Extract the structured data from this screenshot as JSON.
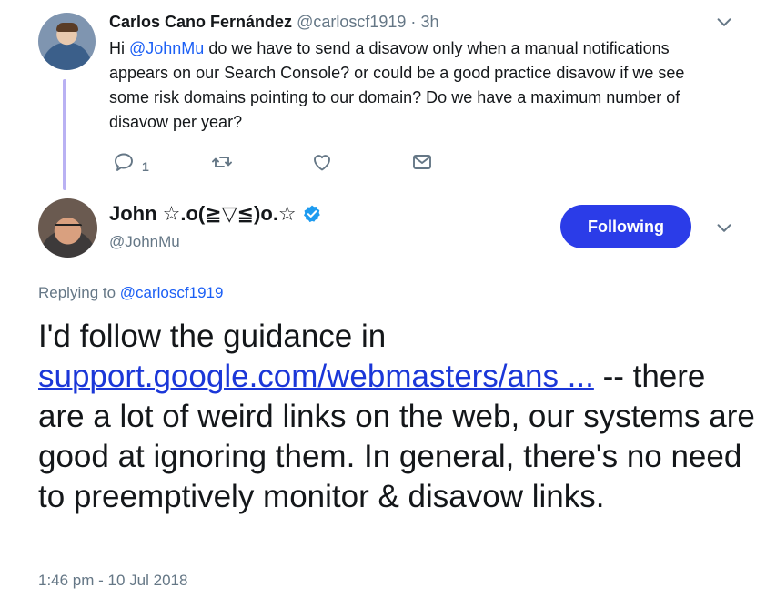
{
  "parent_tweet": {
    "author_name": "Carlos Cano Fernández",
    "author_handle": "@carloscf1919",
    "separator": "·",
    "time": "3h",
    "text_prefix": "Hi ",
    "mention": "@JohnMu",
    "text_rest": " do we have to send a disavow only when a manual notifications appears on our Search Console? or could be a good practice disavow if we see some risk domains pointing to our domain? Do we have a maximum number of disavow per year?",
    "reply_count": "1",
    "icons": [
      "reply-icon",
      "retweet-icon",
      "like-icon",
      "direct-message-icon",
      "chevron-down-icon"
    ]
  },
  "main_tweet": {
    "author_name": "John ☆.o(≧▽≦)o.☆",
    "author_handle": "@JohnMu",
    "follow_label": "Following",
    "replying_label": "Replying to ",
    "replying_handle": "@carloscf1919",
    "text_before_link": "I'd follow the guidance in ",
    "link_text": "support.google.com/webmasters/ans ...",
    "text_after_link": " -- there are a lot of weird links on the web, our systems are good at ignoring them. In general, there's no need to preemptively monitor & disavow links.",
    "timestamp": "1:46 pm - 10 Jul 2018",
    "icons": [
      "verified-badge-icon",
      "chevron-down-icon"
    ]
  },
  "colors": {
    "accent": "#2b3ce8",
    "link": "#1b37d8",
    "mention": "#1b5ff5",
    "muted": "#657786",
    "thread_line": "#b9b1f3"
  }
}
